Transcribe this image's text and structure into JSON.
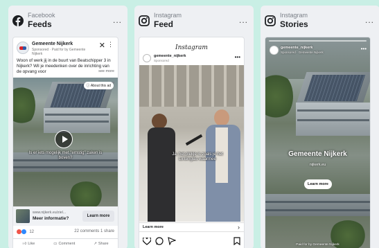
{
  "cards": [
    {
      "platform": "Facebook",
      "placement": "Feeds",
      "more": "...",
      "post": {
        "page_name": "Gemeente Nijkerk",
        "sponsored_line": "Sponsored · Paid for by Gemeente Nijkerk",
        "text": "Woon of werk jij in de buurt van Beatschipper 3 in Nijkerk? Wil je meedenken over de inrichting van de opvang voor",
        "see_more": "see more",
        "about_ad": "About this ad",
        "caption": "Is er iets mogelijk met \"ernstig\" zaken is boven?",
        "cta_url": "www.nijkerk.eu/ziel...",
        "cta_title": "Meer informatie?",
        "cta_button": "Learn more",
        "reaction_count": "12",
        "counts": "22 comments  1 share",
        "actions": [
          "Like",
          "Comment",
          "Share"
        ]
      }
    },
    {
      "platform": "Instagram",
      "placement": "Feed",
      "more": "...",
      "post": {
        "app_logo": "Instagram",
        "username": "gemeente_nijkerk",
        "sponsored_line": "Sponsored",
        "caption": "Ja, het plekje is zoals je het Lintenglas waarmee",
        "cta": "Learn more"
      }
    },
    {
      "platform": "Instagram",
      "placement": "Stories",
      "more": "...",
      "post": {
        "username": "gemeente_nijkerk",
        "sponsored_line": "Sponsored · Gemeente Nijkerk",
        "title": "Gemeente Nijkerk",
        "url": "nijkerk.eu",
        "cta": "Learn more",
        "footer": "Paid for by Gemeente Nijkerk"
      }
    }
  ]
}
